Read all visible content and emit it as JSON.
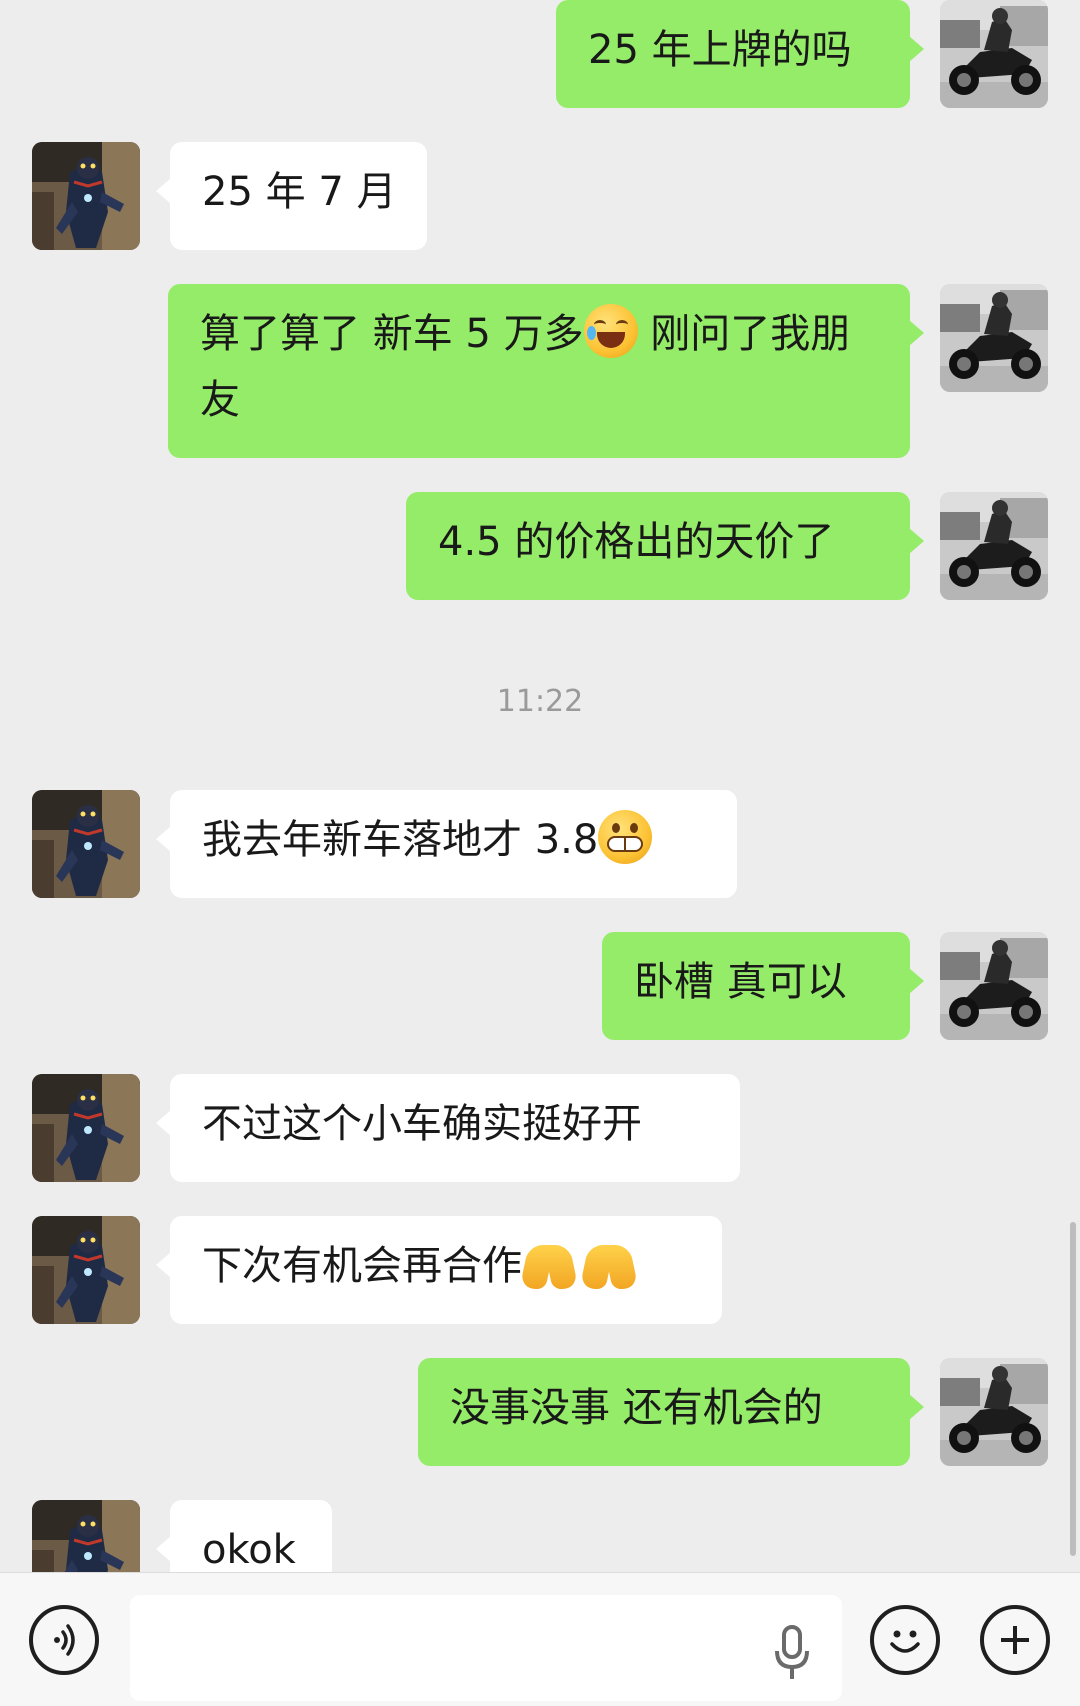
{
  "messages": [
    {
      "side": "out",
      "text": "25 年上牌的吗"
    },
    {
      "side": "in",
      "text": "25 年 7 月"
    },
    {
      "side": "out",
      "text_before": "算了算了 新车 5 万多",
      "emoji": "face-with-tears-of-joy",
      "text_after": " 刚问了我朋友"
    },
    {
      "side": "out",
      "text": "4.5 的价格出的天价了"
    },
    {
      "side": "time",
      "text": "11:22"
    },
    {
      "side": "in",
      "text_before": "我去年新车落地才 3.8",
      "emoji": "grimacing-face"
    },
    {
      "side": "out",
      "text": "卧槽 真可以"
    },
    {
      "side": "in",
      "text": "不过这个小车确实挺好开"
    },
    {
      "side": "in",
      "text_before": "下次有机会再合作",
      "emoji": "folded-hands x2"
    },
    {
      "side": "out",
      "text": "没事没事 还有机会的"
    },
    {
      "side": "in",
      "text": "okok"
    }
  ],
  "input_bar": {
    "voice_icon": "voice-toggle-icon",
    "mic_icon": "microphone-icon",
    "emoji_icon": "emoji-face-icon",
    "plus_icon": "plus-icon",
    "placeholder": ""
  },
  "colors": {
    "outgoing": "#95ec69",
    "incoming": "#ffffff",
    "background": "#ededed"
  }
}
